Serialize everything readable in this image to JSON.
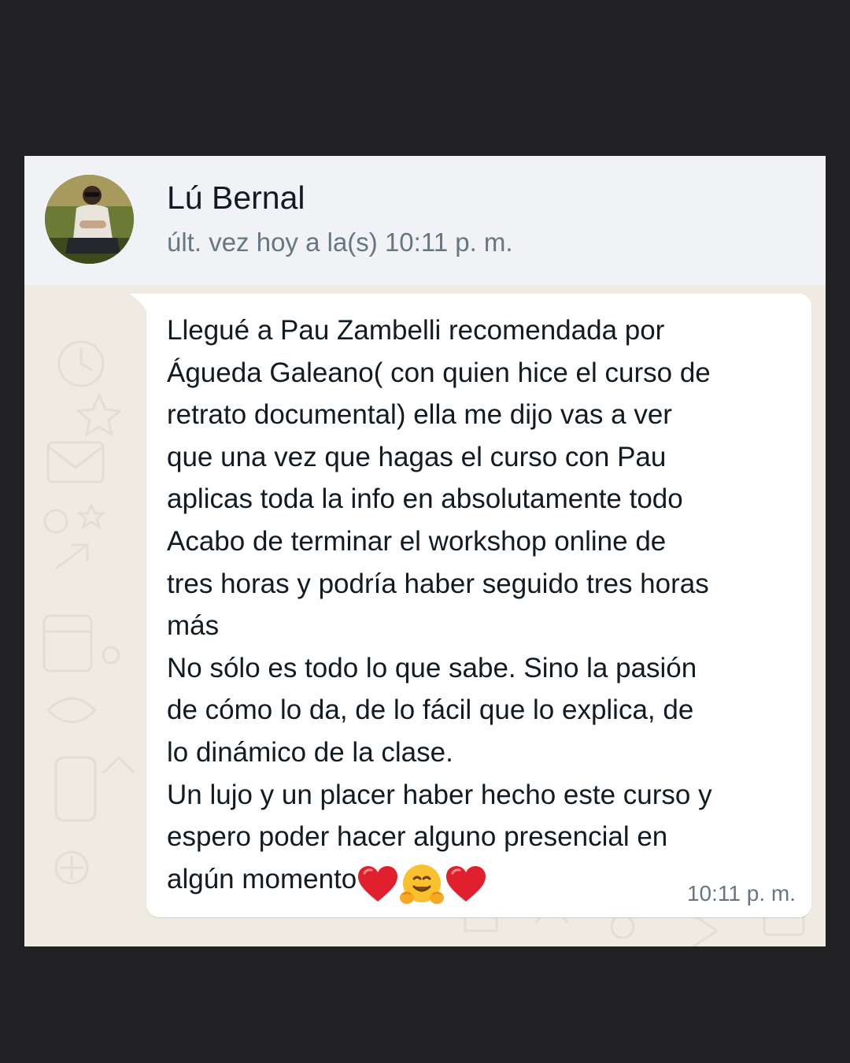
{
  "header": {
    "contact_name": "Lú Bernal",
    "last_seen": "últ. vez hoy a la(s) 10:11 p. m.",
    "avatar_icon": "contact-avatar-photo"
  },
  "message": {
    "lines": "Llegué a Pau Zambelli  recomendada por\nÁgueda Galeano( con quien hice el curso de\nretrato documental) ella me dijo vas a ver\nque una vez que hagas el curso con Pau\naplicas toda la info en absolutamente todo\nAcabo de terminar el workshop online de\ntres horas y podría haber seguido tres horas\nmás\nNo sólo es todo lo que sabe.  Sino la pasión\nde cómo lo da, de lo fácil que lo explica, de\nlo dinámico de la clase.\nUn lujo y un placer haber hecho este curso y\nespero poder hacer alguno presencial en\n",
    "last_line": "algún momento",
    "emojis": [
      "red-heart-icon",
      "hugging-face-icon",
      "red-heart-icon"
    ],
    "time": "10:11 p. m."
  },
  "colors": {
    "page_background": "#212123",
    "header_background": "#f0f2f5",
    "chat_wallpaper": "#efeae2",
    "bubble": "#ffffff",
    "primary_text": "#111b21",
    "secondary_text": "#667781"
  }
}
